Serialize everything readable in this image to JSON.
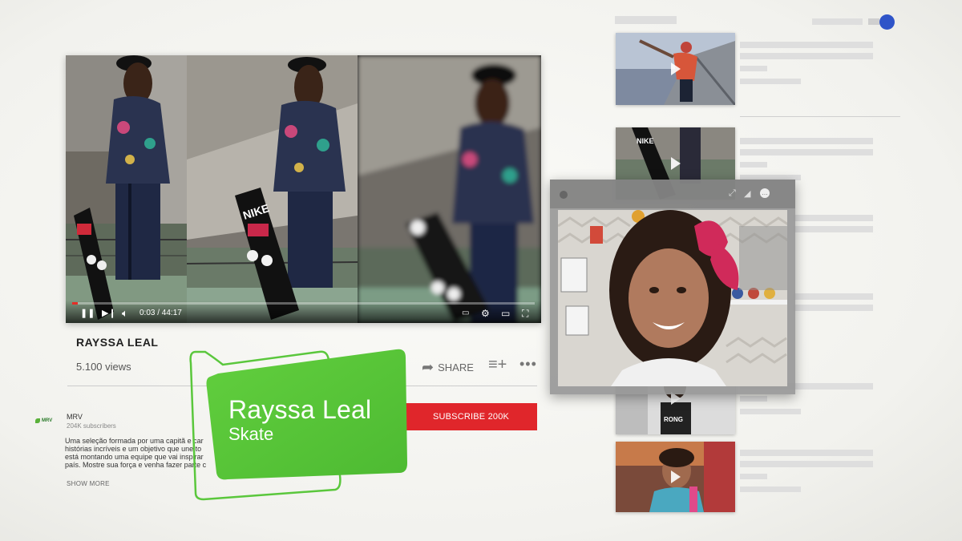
{
  "player": {
    "time": "0:03 / 44:17",
    "progress": 0.012,
    "icons": {
      "pause": "pause-icon",
      "next": "next-icon",
      "volume": "volume-icon",
      "subtitles": "subtitles-icon",
      "settings": "settings-icon",
      "theater": "theater-icon",
      "fullscreen": "fullscreen-icon"
    }
  },
  "video": {
    "title": "RAYSSA LEAL",
    "views": "5.100 views",
    "share_label": "SHARE"
  },
  "channel": {
    "logo_text": "MRV",
    "name": "MRV",
    "subscribers": "204K subscribers",
    "description_lines": [
      "Uma seleção formada por uma capitã e car",
      "histórias incríveis e um objetivo que une to",
      "está montando uma equipe que vai inspirar",
      "país. Mostre sua força e venha fazer parte c"
    ],
    "show_more": "SHOW MORE",
    "subscribe_label": "SUBSCRIBE 200K"
  },
  "lower_third": {
    "name": "Rayssa Leal",
    "subtitle": "Skate"
  },
  "colors": {
    "accent_green": "#5ac73c",
    "subscribe_red": "#e0262b",
    "progress_red": "#e52d27",
    "toggle_blue": "#2f54c8"
  }
}
